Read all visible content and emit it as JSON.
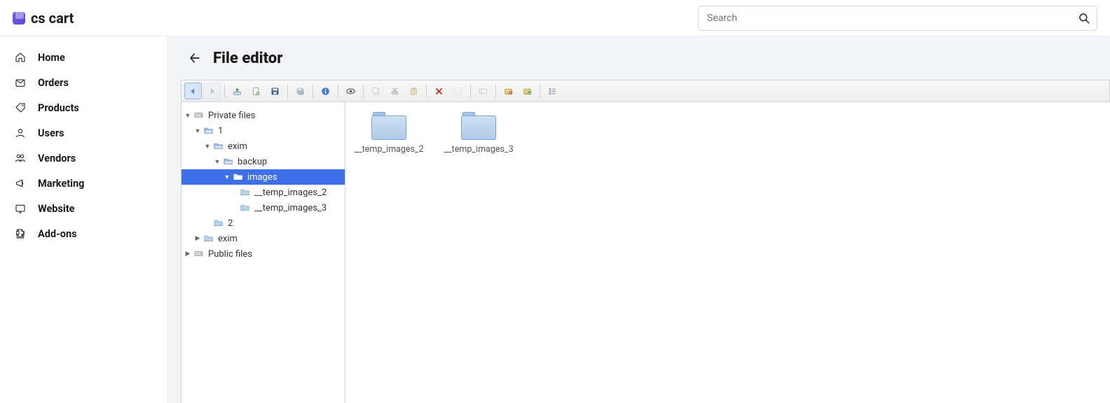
{
  "brand": "cs cart",
  "search": {
    "placeholder": "Search"
  },
  "nav": [
    {
      "label": "Home"
    },
    {
      "label": "Orders"
    },
    {
      "label": "Products"
    },
    {
      "label": "Users"
    },
    {
      "label": "Vendors"
    },
    {
      "label": "Marketing"
    },
    {
      "label": "Website"
    },
    {
      "label": "Add-ons"
    }
  ],
  "page": {
    "title": "File editor"
  },
  "tree": {
    "root0": "Private files",
    "r0_0": "1",
    "r0_0_0": "exim",
    "r0_0_0_0": "backup",
    "r0_0_0_0_0": "images",
    "r0_0_0_0_0_0": "__temp_images_2",
    "r0_0_0_0_0_1": "__temp_images_3",
    "r0_1": "2",
    "r0_2": "exim",
    "root1": "Public files"
  },
  "files": [
    {
      "name": "__temp_images_2"
    },
    {
      "name": "__temp_images_3"
    }
  ]
}
